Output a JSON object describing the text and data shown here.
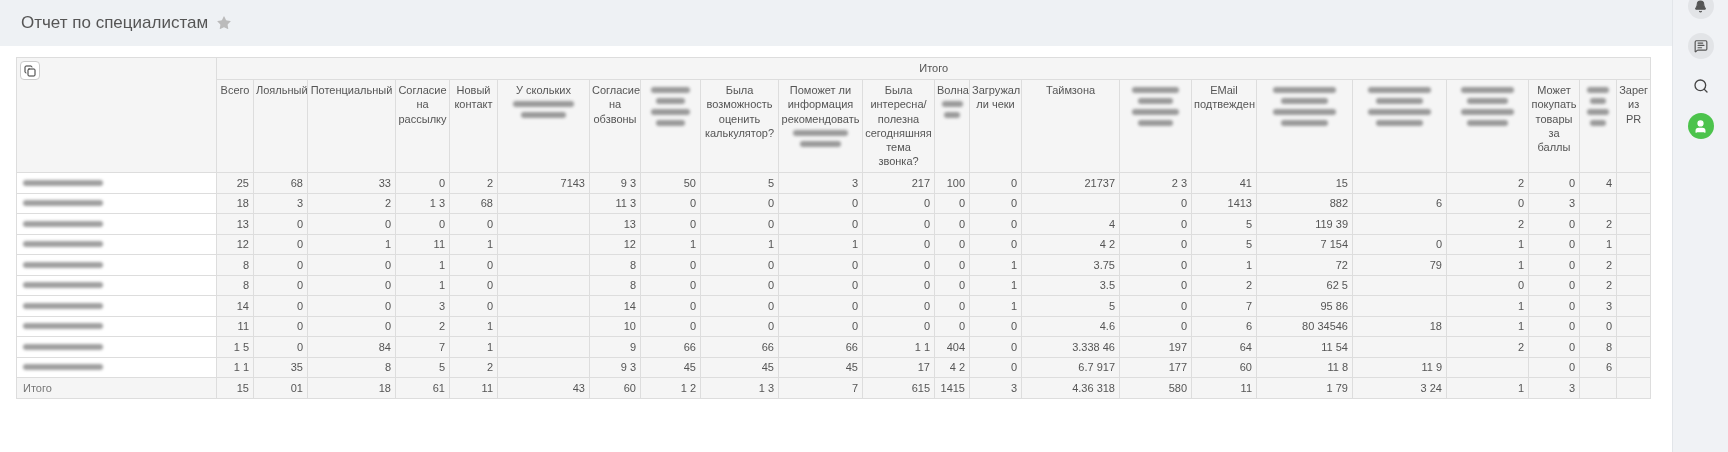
{
  "page": {
    "title": "Отчет по специалистам",
    "favorite": false
  },
  "table": {
    "group_heading": "Итого",
    "columns": [
      {
        "kind": "text",
        "label": "Всего"
      },
      {
        "kind": "text",
        "label": "Лояльный"
      },
      {
        "kind": "text",
        "label": "Потенциальный"
      },
      {
        "kind": "text",
        "label": "Согласие на рассылку"
      },
      {
        "kind": "text",
        "label": "Новый контакт"
      },
      {
        "kind": "text_blurred",
        "label": "У скольких"
      },
      {
        "kind": "text",
        "label": "Согласие на обзвоны"
      },
      {
        "kind": "blurred"
      },
      {
        "kind": "text",
        "label": "Была возможность оценить калькулятор?"
      },
      {
        "kind": "text_blurred",
        "label": "Поможет ли информация рекомендовать"
      },
      {
        "kind": "text",
        "label": "Была интересна/ полезна сегодняшняя тема звонка?"
      },
      {
        "kind": "text_blurred",
        "label": "Волна"
      },
      {
        "kind": "text",
        "label": "Загружал ли чеки"
      },
      {
        "kind": "text",
        "label": "Таймзона"
      },
      {
        "kind": "blurred"
      },
      {
        "kind": "text",
        "label": "EMail подтвежден"
      },
      {
        "kind": "blurred"
      },
      {
        "kind": "blurred"
      },
      {
        "kind": "blurred"
      },
      {
        "kind": "text",
        "label": "Может покупать товары за баллы"
      },
      {
        "kind": "blurred"
      },
      {
        "kind": "text",
        "label": "Зарег из PR"
      }
    ],
    "rows": [
      {
        "kind": "person",
        "cells": [
          "25",
          "68",
          "33",
          "0",
          "2",
          "7143",
          "9 3",
          "50",
          "5",
          "3",
          "217",
          "100",
          "0",
          "21737",
          "2 3",
          "41",
          "15",
          null,
          "2",
          "0",
          "4",
          null
        ]
      },
      {
        "kind": "person",
        "cells": [
          "18",
          "3",
          "2",
          "1 3",
          "68",
          null,
          "11 3",
          "0",
          "0",
          "0",
          "0",
          "0",
          "0",
          null,
          "0",
          "1413",
          "882",
          "6",
          "0",
          "3",
          null,
          null
        ]
      },
      {
        "kind": "person",
        "cells": [
          "13",
          "0",
          "0",
          "0",
          "0",
          null,
          "13",
          "0",
          "0",
          "0",
          "0",
          "0",
          "0",
          "4",
          "0",
          "5",
          "119 39",
          null,
          "2",
          "0",
          "2",
          null
        ]
      },
      {
        "kind": "person",
        "cells": [
          "12",
          "0",
          "1",
          "11",
          "1",
          null,
          "12",
          "1",
          "1",
          "1",
          "0",
          "0",
          "0",
          "4 2",
          "0",
          "5",
          "7 154",
          "0",
          "1",
          "0",
          "1",
          null
        ]
      },
      {
        "kind": "person",
        "cells": [
          "8",
          "0",
          "0",
          "1",
          "0",
          null,
          "8",
          "0",
          "0",
          "0",
          "0",
          "0",
          "1",
          "3.75",
          "0",
          "1",
          "72",
          "79",
          "1",
          "0",
          "2",
          null
        ]
      },
      {
        "kind": "person",
        "cells": [
          "8",
          "0",
          "0",
          "1",
          "0",
          null,
          "8",
          "0",
          "0",
          "0",
          "0",
          "0",
          "1",
          "3.5",
          "0",
          "2",
          "62 5",
          null,
          "0",
          "0",
          "2",
          null
        ]
      },
      {
        "kind": "person",
        "cells": [
          "14",
          "0",
          "0",
          "3",
          "0",
          null,
          "14",
          "0",
          "0",
          "0",
          "0",
          "0",
          "1",
          "5",
          "0",
          "7",
          "95 86",
          null,
          "1",
          "0",
          "3",
          null
        ]
      },
      {
        "kind": "person",
        "cells": [
          "11",
          "0",
          "0",
          "2",
          "1",
          null,
          "10",
          "0",
          "0",
          "0",
          "0",
          "0",
          "0",
          "4.6",
          "0",
          "6",
          "80 34546",
          "18",
          "1",
          "0",
          "0",
          null
        ]
      },
      {
        "kind": "person",
        "cells": [
          "1 5",
          "0",
          "84",
          "7",
          "1",
          null,
          "9",
          "66",
          "66",
          "66",
          "1 1",
          "404",
          "0",
          "3.338 46",
          "197",
          "64",
          "11 54",
          null,
          "2",
          "0",
          "8",
          null
        ]
      },
      {
        "kind": "person",
        "cells": [
          "1 1",
          "35",
          "8",
          "5",
          "2",
          null,
          "9 3",
          "45",
          "45",
          "45",
          "17",
          "4 2",
          "0",
          "6.7 917",
          "177",
          "60",
          "11 8",
          "11 9",
          null,
          "0",
          "6",
          null
        ]
      },
      {
        "kind": "total",
        "label": "Итого",
        "cells": [
          "15",
          "01",
          "18",
          "61",
          "11",
          "43",
          "60",
          "1 2",
          "1 3",
          "7",
          "615",
          "1415",
          "3",
          "4.36 318",
          "580",
          "11",
          "1 79",
          "3 24",
          "1",
          "3",
          null,
          null
        ]
      }
    ]
  }
}
